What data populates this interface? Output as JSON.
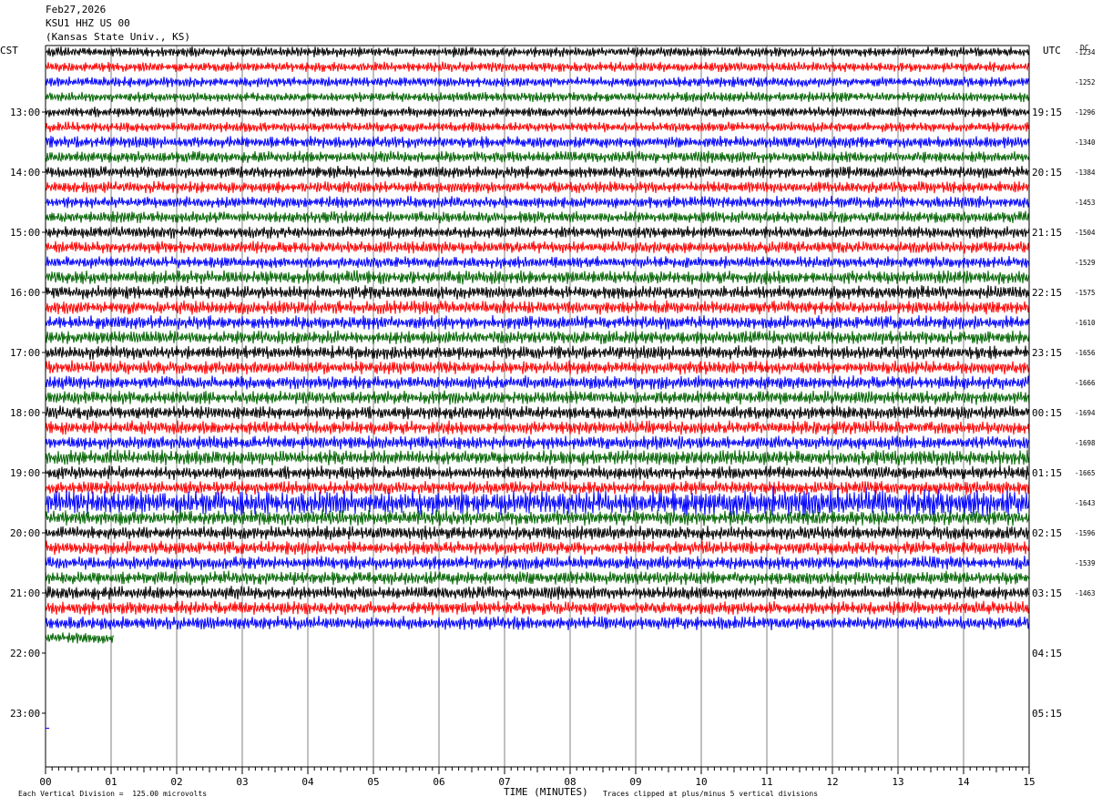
{
  "header": {
    "date": "Feb27,2026",
    "station": "KSU1 HHZ US 00",
    "site": "(Kansas State Univ., KS)"
  },
  "axes": {
    "left_zone": "CST",
    "right_zone": "UTC",
    "dc_label": "DC",
    "xlabel": "TIME (MINUTES)",
    "x_ticks": [
      "00",
      "01",
      "02",
      "03",
      "04",
      "05",
      "06",
      "07",
      "08",
      "09",
      "10",
      "11",
      "12",
      "13",
      "14",
      "15"
    ],
    "left_hours": [
      "13:00",
      "14:00",
      "15:00",
      "16:00",
      "17:00",
      "18:00",
      "19:00",
      "20:00",
      "21:00",
      "22:00",
      "23:00"
    ],
    "right_hours": [
      "19:15",
      "20:15",
      "21:15",
      "22:15",
      "23:15",
      "00:15",
      "01:15",
      "02:15",
      "03:15",
      "04:15",
      "05:15"
    ]
  },
  "footer": {
    "scale_note": "Each Vertical Division =  125.00 microvolts",
    "clip_note": "Traces clipped at plus/minus 5 vertical divisions"
  },
  "chart_data": {
    "type": "line",
    "title": "KSU1 HHZ US 00 (Kansas State Univ., KS)",
    "xlabel": "TIME (MINUTES)",
    "xlim": [
      0,
      15
    ],
    "rows_per_hour": 4,
    "trace_colors": [
      "#000000",
      "#ff0000",
      "#0000ff",
      "#006400"
    ],
    "grid": "vertical at each minute",
    "first_row_start_cst": "12:00",
    "dc_offsets": [
      "-1234",
      "-1252",
      "-1296",
      "-1340",
      "-1384",
      "-1453",
      "-1504",
      "-1529",
      "-1575",
      "-1610",
      "-1656",
      "-1666",
      "-1694",
      "-1698",
      "-1665",
      "-1643",
      "-1596",
      "-1539",
      "-1463"
    ],
    "traces": [
      {
        "row": 0,
        "amp": 6
      },
      {
        "row": 1,
        "amp": 6
      },
      {
        "row": 2,
        "amp": 6
      },
      {
        "row": 3,
        "amp": 6
      },
      {
        "row": 4,
        "amp": 6
      },
      {
        "row": 5,
        "amp": 6
      },
      {
        "row": 6,
        "amp": 7
      },
      {
        "row": 7,
        "amp": 7
      },
      {
        "row": 8,
        "amp": 7
      },
      {
        "row": 9,
        "amp": 7
      },
      {
        "row": 10,
        "amp": 7
      },
      {
        "row": 11,
        "amp": 7
      },
      {
        "row": 12,
        "amp": 7
      },
      {
        "row": 13,
        "amp": 7
      },
      {
        "row": 14,
        "amp": 7
      },
      {
        "row": 15,
        "amp": 8
      },
      {
        "row": 16,
        "amp": 8
      },
      {
        "row": 17,
        "amp": 8
      },
      {
        "row": 18,
        "amp": 8
      },
      {
        "row": 19,
        "amp": 8
      },
      {
        "row": 20,
        "amp": 8
      },
      {
        "row": 21,
        "amp": 8
      },
      {
        "row": 22,
        "amp": 8
      },
      {
        "row": 23,
        "amp": 8
      },
      {
        "row": 24,
        "amp": 8
      },
      {
        "row": 25,
        "amp": 8
      },
      {
        "row": 26,
        "amp": 8
      },
      {
        "row": 27,
        "amp": 9
      },
      {
        "row": 28,
        "amp": 8
      },
      {
        "row": 29,
        "amp": 8
      },
      {
        "row": 30,
        "amp": 14,
        "burst": [
          9.5,
          15
        ]
      },
      {
        "row": 31,
        "amp": 9
      },
      {
        "row": 32,
        "amp": 8
      },
      {
        "row": 33,
        "amp": 8
      },
      {
        "row": 34,
        "amp": 8
      },
      {
        "row": 35,
        "amp": 8
      },
      {
        "row": 36,
        "amp": 8
      },
      {
        "row": 37,
        "amp": 8
      },
      {
        "row": 38,
        "amp": 8
      },
      {
        "row": 39,
        "amp": 7,
        "end_minute": 1.05
      }
    ]
  }
}
